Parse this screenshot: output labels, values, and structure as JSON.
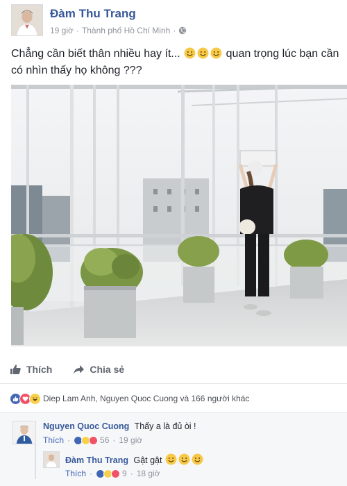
{
  "post": {
    "author": "Đàm Thu Trang",
    "time": "19 giờ",
    "separator": "·",
    "location": "Thành phố Hồ Chí Minh",
    "text_line1_a": "Chẳng cần biết thân nhiều hay ít...",
    "text_line1_b": "quan trọng lúc bạn cần",
    "text_line2": "có nhìn thấy họ không ???",
    "privacy_icon": "globe-icon"
  },
  "actions": {
    "like_label": "Thích",
    "share_label": "Chia sẻ"
  },
  "reactions": {
    "summary": "Diep Lam Anh, Nguyen Quoc Cuong và 166 người khác",
    "icons": [
      "like",
      "love",
      "haha"
    ]
  },
  "comments": [
    {
      "author": "Nguyen Quoc Cuong",
      "text": "Thấy a là đủ òi !",
      "like_label": "Thích",
      "dot": "·",
      "reaction_count": "56",
      "time": "19 giờ"
    }
  ],
  "reply": {
    "author": "Đàm Thu Trang",
    "text": "Gật gật",
    "like_label": "Thích",
    "dot": "·",
    "reaction_count": "9",
    "time": "18 giờ"
  },
  "colors": {
    "link": "#365899",
    "like_blue": "#4267b2",
    "meta_gray": "#90949c",
    "love_red": "#f25268",
    "haha_yellow": "#f7d14c"
  }
}
